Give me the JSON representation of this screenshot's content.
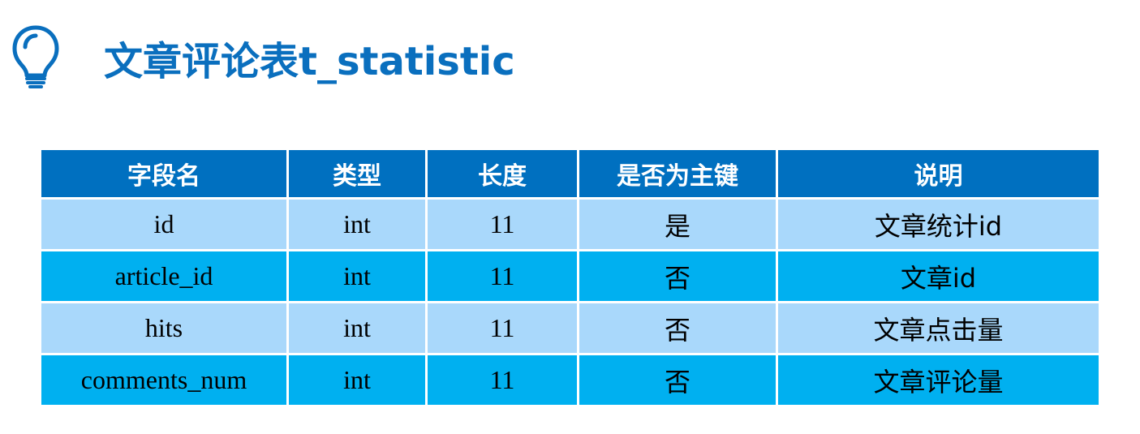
{
  "title": "文章评论表t_statistic",
  "colors": {
    "title": "#0a6fbe",
    "header_bg": "#0070c0",
    "row_light": "#a9d8fb",
    "row_dark": "#00b0f0"
  },
  "icon": "lightbulb-icon",
  "table": {
    "headers": [
      "字段名",
      "类型",
      "长度",
      "是否为主键",
      "说明"
    ],
    "rows": [
      {
        "field": "id",
        "type": "int",
        "length": "11",
        "primary_key": "是",
        "description": "文章统计id"
      },
      {
        "field": "article_id",
        "type": "int",
        "length": "11",
        "primary_key": "否",
        "description": "文章id"
      },
      {
        "field": "hits",
        "type": "int",
        "length": "11",
        "primary_key": "否",
        "description": "文章点击量"
      },
      {
        "field": "comments_num",
        "type": "int",
        "length": "11",
        "primary_key": "否",
        "description": "文章评论量"
      }
    ]
  }
}
